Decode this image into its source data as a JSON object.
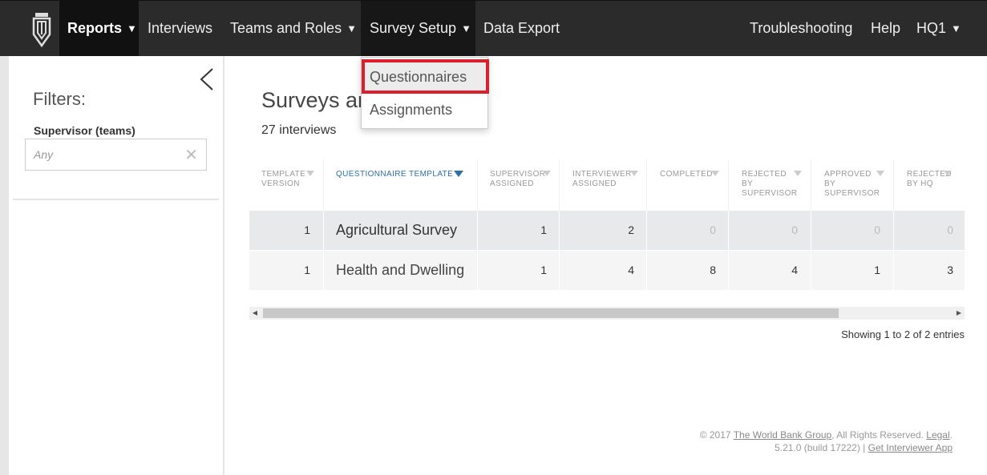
{
  "navbar": {
    "logo_icon": "pen-nib-logo-icon",
    "items": [
      {
        "label": "Reports",
        "has_caret": true
      },
      {
        "label": "Interviews"
      },
      {
        "label": "Teams and Roles",
        "has_caret": true
      },
      {
        "label": "Survey Setup",
        "has_caret": true
      },
      {
        "label": "Data Export"
      }
    ],
    "right_items": [
      {
        "label": "Troubleshooting"
      },
      {
        "label": "Help"
      },
      {
        "label": "HQ1",
        "has_caret": true
      }
    ],
    "caret": "▼"
  },
  "dropdown": {
    "items": [
      {
        "label": "Questionnaires"
      },
      {
        "label": "Assignments"
      }
    ],
    "highlight_color": "#d9202c"
  },
  "filters": {
    "title": "Filters:",
    "supervisor_label": "Supervisor (teams)",
    "supervisor_placeholder": "Any",
    "clear_icon": "close-icon"
  },
  "main": {
    "title": "Surveys an",
    "count": "27 interviews",
    "showing": "Showing 1 to 2 of 2 entries"
  },
  "table": {
    "headers": [
      "TEMPLATE VERSION",
      "QUESTIONNAIRE TEMPLATE",
      "SUPERVISOR ASSIGNED",
      "INTERVIEWER ASSIGNED",
      "COMPLETED",
      "REJECTED BY SUPERVISOR",
      "APPROVED BY SUPERVISOR",
      "REJECTED BY HQ"
    ],
    "rows": [
      [
        "1",
        "Agricultural Survey",
        "1",
        "2",
        "0",
        "0",
        "0",
        "0"
      ],
      [
        "1",
        "Health and Dwelling",
        "1",
        "4",
        "8",
        "4",
        "1",
        "3"
      ]
    ]
  },
  "footer": {
    "copyright": "© 2017 ",
    "org_link": "The World Bank Group",
    "rights": ", All Rights Reserved. ",
    "legal_link": "Legal",
    "legal_end": ".",
    "version": "5.21.0 (build 17222) | ",
    "app_link": "Get Interviewer App"
  },
  "colors": {
    "navbar_bg": "#2b2b2b",
    "active_nav_bg": "#111111",
    "sort_accent": "#2a6fa6"
  }
}
